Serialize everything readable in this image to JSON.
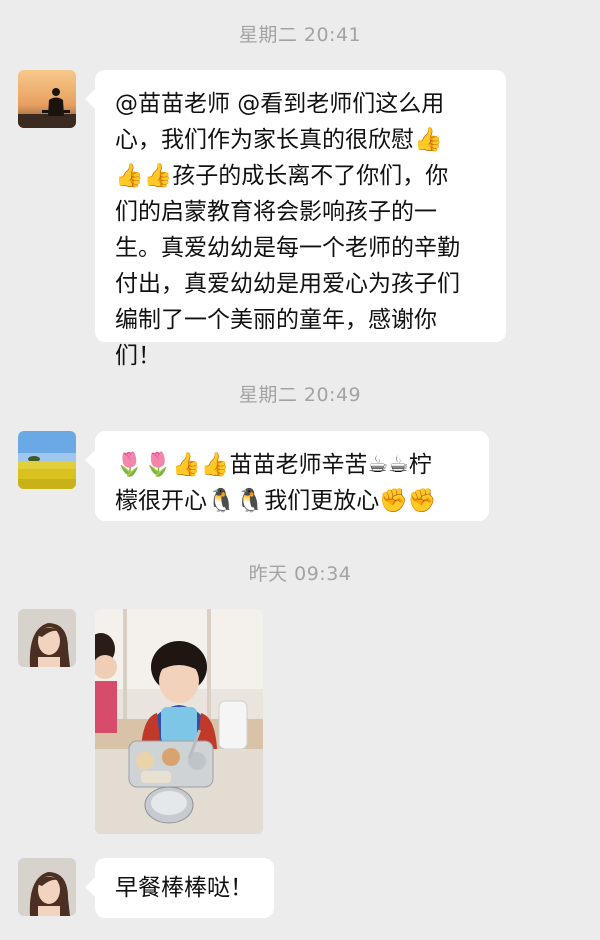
{
  "chat": {
    "messages": [
      {
        "timestamp": "星期二 20:41",
        "text": "@苗苗老师 @看到老师们这么用心，我们作为家长真的很欣慰👍👍👍孩子的成长离不了你们，你们的启蒙教育将会影响孩子的一生。真爱幼幼是每一个老师的辛勤付出，真爱幼幼是用爱心为孩子们编制了一个美丽的童年，感谢你们！",
        "lines": [
          "@苗苗老师 @看到老师们这么用",
          "心，我们作为家长真的很欣慰👍",
          "👍👍孩子的成长离不了你们，你",
          "们的启蒙教育将会影响孩子的一",
          "生。真爱幼幼是每一个老师的辛勤",
          "付出，真爱幼幼是用爱心为孩子们",
          "编制了一个美丽的童年，感谢你",
          "们！"
        ],
        "avatar_icon": "sunset-silhouette-avatar"
      },
      {
        "timestamp": "星期二 20:49",
        "text": "🌷🌷👍👍苗苗老师辛苦☕☕柠檬很开心🐧🐧我们更放心✊✊",
        "lines": [
          "🌷🌷👍👍苗苗老师辛苦☕☕柠",
          "檬很开心🐧🐧我们更放心✊✊"
        ],
        "avatar_icon": "rapeseed-field-avatar"
      },
      {
        "timestamp": "昨天 09:34",
        "image": "child-breakfast-photo",
        "avatar_icon": "woman-portrait-avatar"
      },
      {
        "text": "早餐棒棒哒！",
        "lines": [
          "早餐棒棒哒！"
        ],
        "avatar_icon": "woman-portrait-avatar"
      }
    ]
  },
  "colors": {
    "background": "#ececec",
    "bubble": "#ffffff",
    "timestamp": "#a3a3a3"
  }
}
